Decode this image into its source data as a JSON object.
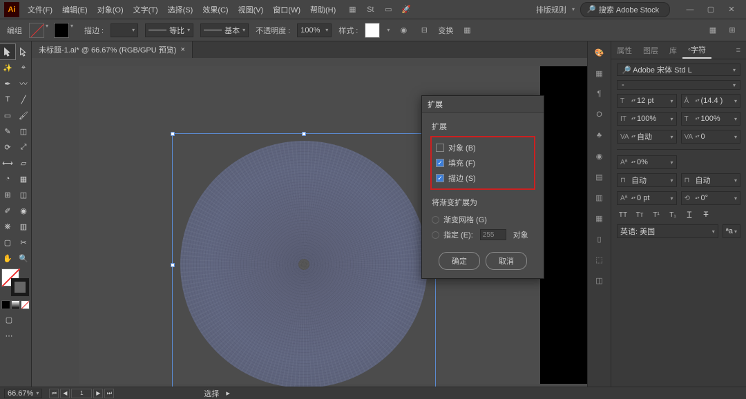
{
  "app": {
    "logo": "Ai",
    "workspace": "排版规则",
    "search_placeholder": "搜索 Adobe Stock"
  },
  "menu": [
    "文件(F)",
    "编辑(E)",
    "对象(O)",
    "文字(T)",
    "选择(S)",
    "效果(C)",
    "视图(V)",
    "窗口(W)",
    "帮助(H)"
  ],
  "ctrlbar": {
    "mode": "编组",
    "stroke_label": "描边 :",
    "stroke_val": "",
    "style1": "等比",
    "style2": "基本",
    "opacity_label": "不透明度 :",
    "opacity_val": "100%",
    "style_label": "样式 :",
    "transform": "变换"
  },
  "doc": {
    "tab": "未标题-1.ai* @ 66.67% (RGB/GPU 预览)"
  },
  "dialog": {
    "title": "扩展",
    "sec1": "扩展",
    "opt_object": "对象 (B)",
    "opt_fill": "填充 (F)",
    "opt_stroke": "描边 (S)",
    "sec2": "将渐变扩展为",
    "opt_mesh": "渐变网格 (G)",
    "opt_spec": "指定 (E):",
    "spec_val": "255",
    "spec_unit": "对象",
    "ok": "确定",
    "cancel": "取消"
  },
  "panel": {
    "tabs": [
      "属性",
      "图层",
      "库",
      "字符"
    ],
    "font": "Adobe 宋体 Std L",
    "fontstyle": "-",
    "size": "12 pt",
    "leading": "(14.4 )",
    "vscale": "100%",
    "hscale": "100%",
    "kerning": "自动",
    "tracking": "0",
    "baseline": "0%",
    "t2": "自动",
    "t2b": "自动",
    "a1": "0 pt",
    "a2": "0°",
    "lang": "英语: 美国"
  },
  "status": {
    "zoom": "66.67%",
    "sel": "选择"
  }
}
